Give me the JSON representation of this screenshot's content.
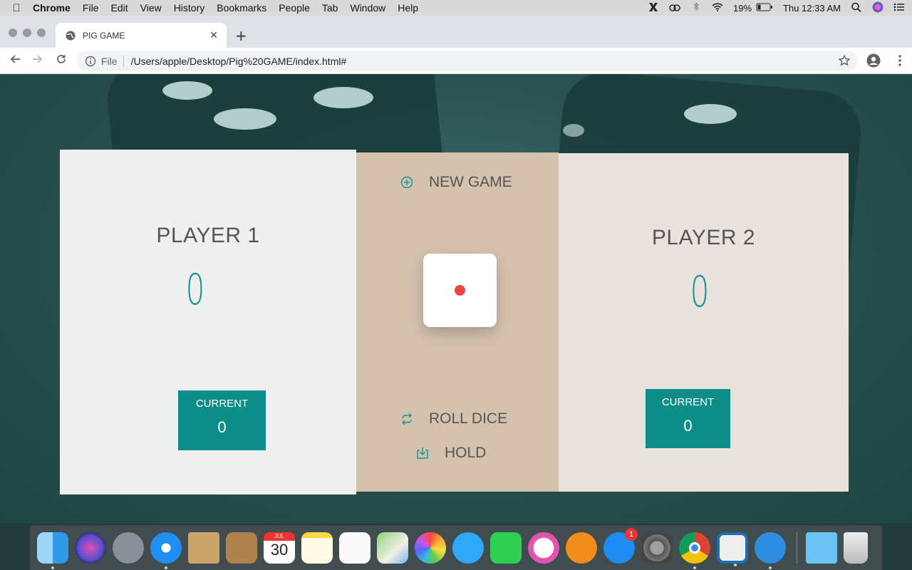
{
  "menubar": {
    "app_name": "Chrome",
    "items": [
      "File",
      "Edit",
      "View",
      "History",
      "Bookmarks",
      "People",
      "Tab",
      "Window",
      "Help"
    ],
    "battery": "19%",
    "clock": "Thu 12:33 AM"
  },
  "browser": {
    "tab_title": "PIG GAME",
    "url_scheme_label": "File",
    "url": "/Users/apple/Desktop/Pig%20GAME/index.html#"
  },
  "game": {
    "player1": {
      "name": "PLAYER 1",
      "score": "0",
      "current_label": "CURRENT",
      "current_value": "0"
    },
    "player2": {
      "name": "PLAYER 2",
      "score": "0",
      "current_label": "CURRENT",
      "current_value": "0"
    },
    "new_game_label": "NEW GAME",
    "roll_dice_label": "ROLL DICE",
    "hold_label": "HOLD",
    "dice_value": 1,
    "accent_color": "#0e8c88",
    "pip_color": "#ee4444"
  },
  "dock": {
    "calendar": {
      "month": "JUL",
      "day": "30"
    },
    "app_store_badge": "1",
    "apps": [
      "Finder",
      "Siri",
      "Launchpad",
      "Safari",
      "Mail",
      "Contacts",
      "Calendar",
      "Notes",
      "Reminders",
      "Maps",
      "Photos",
      "Messages",
      "FaceTime",
      "iTunes",
      "iBooks",
      "App Store",
      "System Preferences",
      "Chrome",
      "Parallels",
      "Wunderlist",
      "Downloads",
      "Trash"
    ]
  }
}
